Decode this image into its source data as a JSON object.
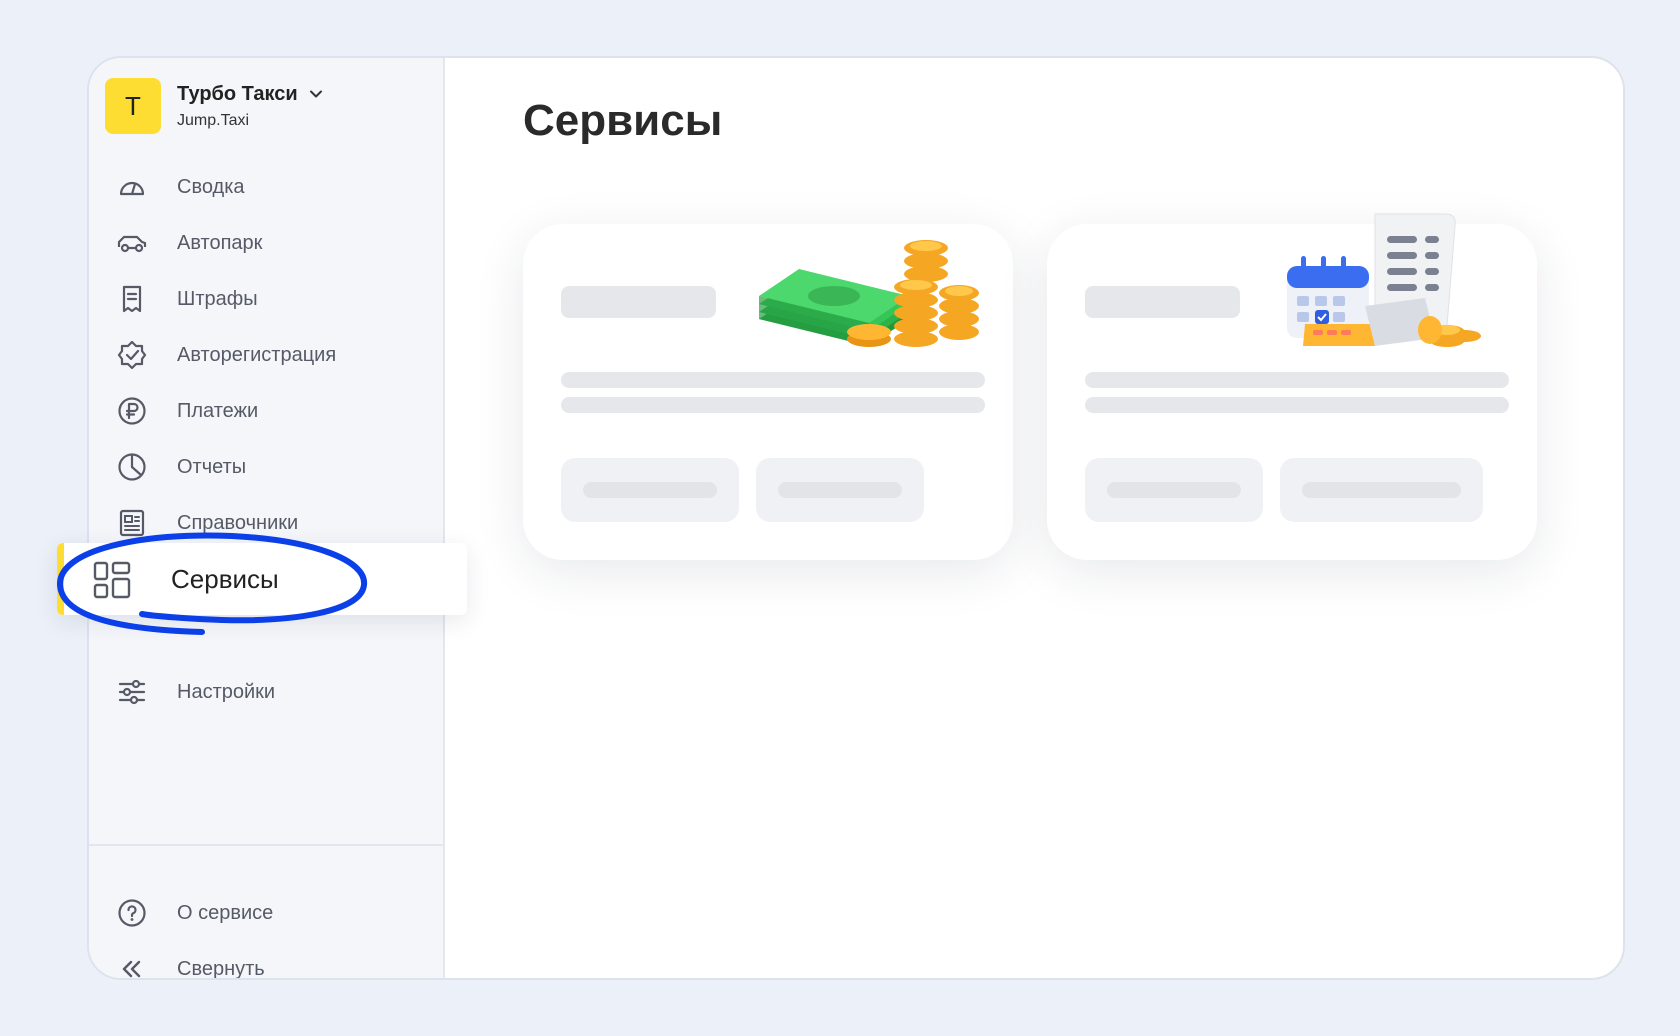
{
  "org": {
    "initial": "Т",
    "name": "Турбо Такси",
    "subtitle": "Jump.Taxi"
  },
  "sidebar": {
    "items": [
      {
        "label": "Сводка",
        "icon": "gauge-icon"
      },
      {
        "label": "Автопарк",
        "icon": "car-icon"
      },
      {
        "label": "Штрафы",
        "icon": "receipt-icon"
      },
      {
        "label": "Авторегистрация",
        "icon": "badge-check-icon"
      },
      {
        "label": "Платежи",
        "icon": "ruble-icon"
      },
      {
        "label": "Отчеты",
        "icon": "pie-chart-icon"
      },
      {
        "label": "Справочники",
        "icon": "reference-icon"
      },
      {
        "label": "Сервисы",
        "icon": "grid-icon",
        "active": true
      },
      {
        "label": "Настройки",
        "icon": "sliders-icon"
      }
    ],
    "footer": [
      {
        "label": "О сервисе",
        "icon": "help-circle-icon"
      },
      {
        "label": "Свернуть",
        "icon": "chevrons-left-icon"
      }
    ]
  },
  "main": {
    "title": "Сервисы"
  },
  "colors": {
    "accent": "#fedd33",
    "annotation": "#0b3fe8",
    "background": "#ecf0f8"
  }
}
